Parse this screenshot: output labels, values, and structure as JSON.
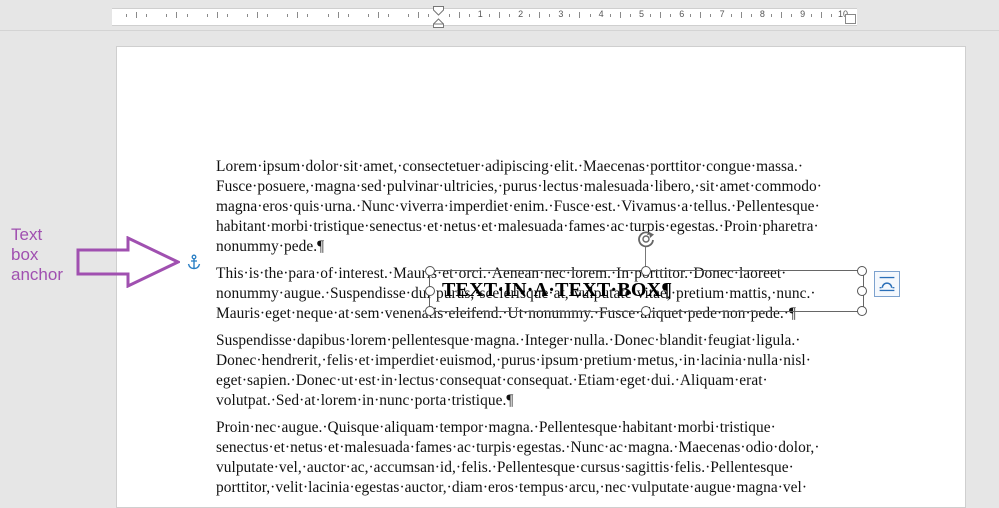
{
  "ruler": {
    "numbers": [
      "1",
      "2",
      "3",
      "4",
      "5",
      "6",
      "7",
      "8",
      "9",
      "10"
    ]
  },
  "annotation": {
    "lines": [
      "Text",
      "box",
      "anchor"
    ],
    "color": "#a050b0",
    "arrow_icon": "arrow-right-outline-icon",
    "anchor_icon": "anchor-icon"
  },
  "document": {
    "paragraphs": [
      {
        "lines": [
          "Lorem·ipsum·dolor·sit·amet,·consectetuer·adipiscing·elit.·Maecenas·porttitor·congue·massa.·",
          "Fusce·posuere,·magna·sed·pulvinar·ultricies,·purus·lectus·malesuada·libero,·sit·amet·commodo·",
          "magna·eros·quis·urna.·Nunc·viverra·imperdiet·enim.·Fusce·est.·Vivamus·a·tellus.·Pellentesque·",
          "habitant·morbi·tristique·senectus·et·netus·et·malesuada·fames·ac·turpis·egestas.·Proin·pharetra·",
          "nonummy·pede.¶"
        ]
      },
      {
        "lines": [
          "This·is·the·para·of·interest.·Mauris·et·orci.·Aenean·nec·lorem.·In·porttitor.·Donec·laoreet·",
          "nonummy·augue.·Suspendisse·dui·purus,·scelerisque·at,·vulputate·vitae,·pretium·mattis,·nunc.·",
          "Mauris·eget·neque·at·sem·venenatis·eleifend.·Ut·nonummy.·Fusce·aliquet·pede·non·pede.·¶"
        ]
      },
      {
        "lines": [
          "Suspendisse·dapibus·lorem·pellentesque·magna.·Integer·nulla.·Donec·blandit·feugiat·ligula.·",
          "Donec·hendrerit,·felis·et·imperdiet·euismod,·purus·ipsum·pretium·metus,·in·lacinia·nulla·nisl·",
          "eget·sapien.·Donec·ut·est·in·lectus·consequat·consequat.·Etiam·eget·dui.·Aliquam·erat·",
          "volutpat.·Sed·at·lorem·in·nunc·porta·tristique.¶"
        ]
      },
      {
        "lines": [
          "Proin·nec·augue.·Quisque·aliquam·tempor·magna.·Pellentesque·habitant·morbi·tristique·",
          "senectus·et·netus·et·malesuada·fames·ac·turpis·egestas.·Nunc·ac·magna.·Maecenas·odio·dolor,·",
          "vulputate·vel,·auctor·ac,·accumsan·id,·felis.·Pellentesque·cursus·sagittis·felis.·Pellentesque·",
          "porttitor,·velit·lacinia·egestas·auctor,·diam·eros·tempus·arcu,·nec·vulputate·augue·magna·vel·"
        ]
      }
    ]
  },
  "textbox": {
    "text": "TEXT·IN·A·TEXT·BOX¶",
    "rotate_icon": "rotate-handle-icon",
    "layout_options_icon": "layout-options-icon"
  }
}
